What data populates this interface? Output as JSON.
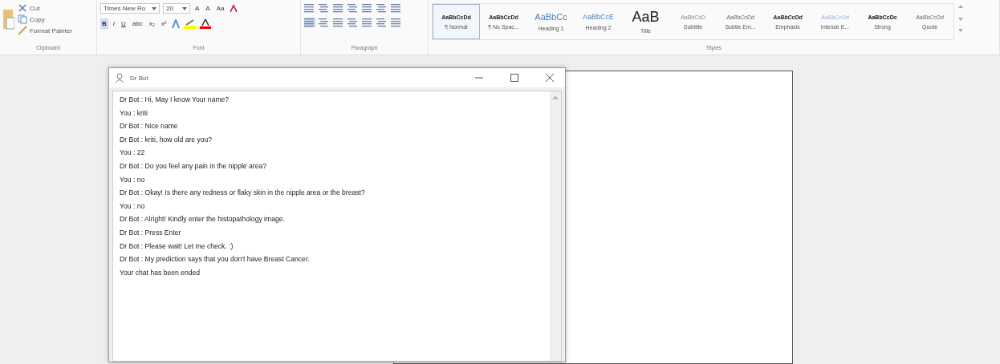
{
  "ribbon": {
    "clipboard": {
      "items": [
        "Cut",
        "Copy",
        "Format Painter"
      ],
      "label": "Clipboard"
    },
    "font": {
      "name": "Times New Ro",
      "size": "20",
      "row1": [
        "A",
        "A",
        "Aa"
      ],
      "row2": [
        "B",
        "I",
        "U",
        "abc",
        "x₂",
        "x²"
      ],
      "label": "Font"
    },
    "paragraph": {
      "label": "Paragraph"
    },
    "styles": {
      "label": "Styles",
      "items": [
        {
          "preview": "AaBbCcDd",
          "name": "¶ Normal",
          "selected": true,
          "kind": "bold"
        },
        {
          "preview": "AaBbCcDd",
          "name": "¶ No Spac...",
          "selected": false,
          "kind": "bold"
        },
        {
          "preview": "AaBbCc",
          "name": "Heading 1",
          "selected": false,
          "kind": "heading"
        },
        {
          "preview": "AaBbCcE",
          "name": "Heading 2",
          "selected": false,
          "kind": "heading2"
        },
        {
          "preview": "AaB",
          "name": "Title",
          "selected": false,
          "kind": "title"
        },
        {
          "preview": "AaBbCcD",
          "name": "Subtitle",
          "selected": false,
          "kind": "light"
        },
        {
          "preview": "AaBbCcDd",
          "name": "Subtle Em...",
          "selected": false,
          "kind": "italic"
        },
        {
          "preview": "AaBbCcDd",
          "name": "Emphasis",
          "selected": false,
          "kind": "italicbold"
        },
        {
          "preview": "AaBbCcDd",
          "name": "Intense E...",
          "selected": false,
          "kind": "accent"
        },
        {
          "preview": "AaBbCcDc",
          "name": "Strong",
          "selected": false,
          "kind": "strong"
        },
        {
          "preview": "AaBbCcDd",
          "name": "Quote",
          "selected": false,
          "kind": "italic"
        }
      ]
    }
  },
  "chat_window": {
    "title": "Dr Bot",
    "messages": [
      "Dr Bot : Hi, May I know Your name?",
      "You : kriti",
      "Dr Bot : Nice name",
      "Dr Bot : kriti, how old are you?",
      "You : 22",
      "Dr Bot : Do you feel any pain in the nipple area?",
      "You : no",
      "Dr Bot : Okay! Is there any redness or flaky skin in the nipple area or the breast?",
      "You : no",
      "Dr Bot : Alright! Kindly enter the histopathology image.",
      "Dr Bot : Press Enter",
      "Dr Bot : Please wait! Let me check. :)",
      "Dr Bot : My prediction says that you don't have Breast Cancer.",
      "Your chat has been ended"
    ]
  }
}
